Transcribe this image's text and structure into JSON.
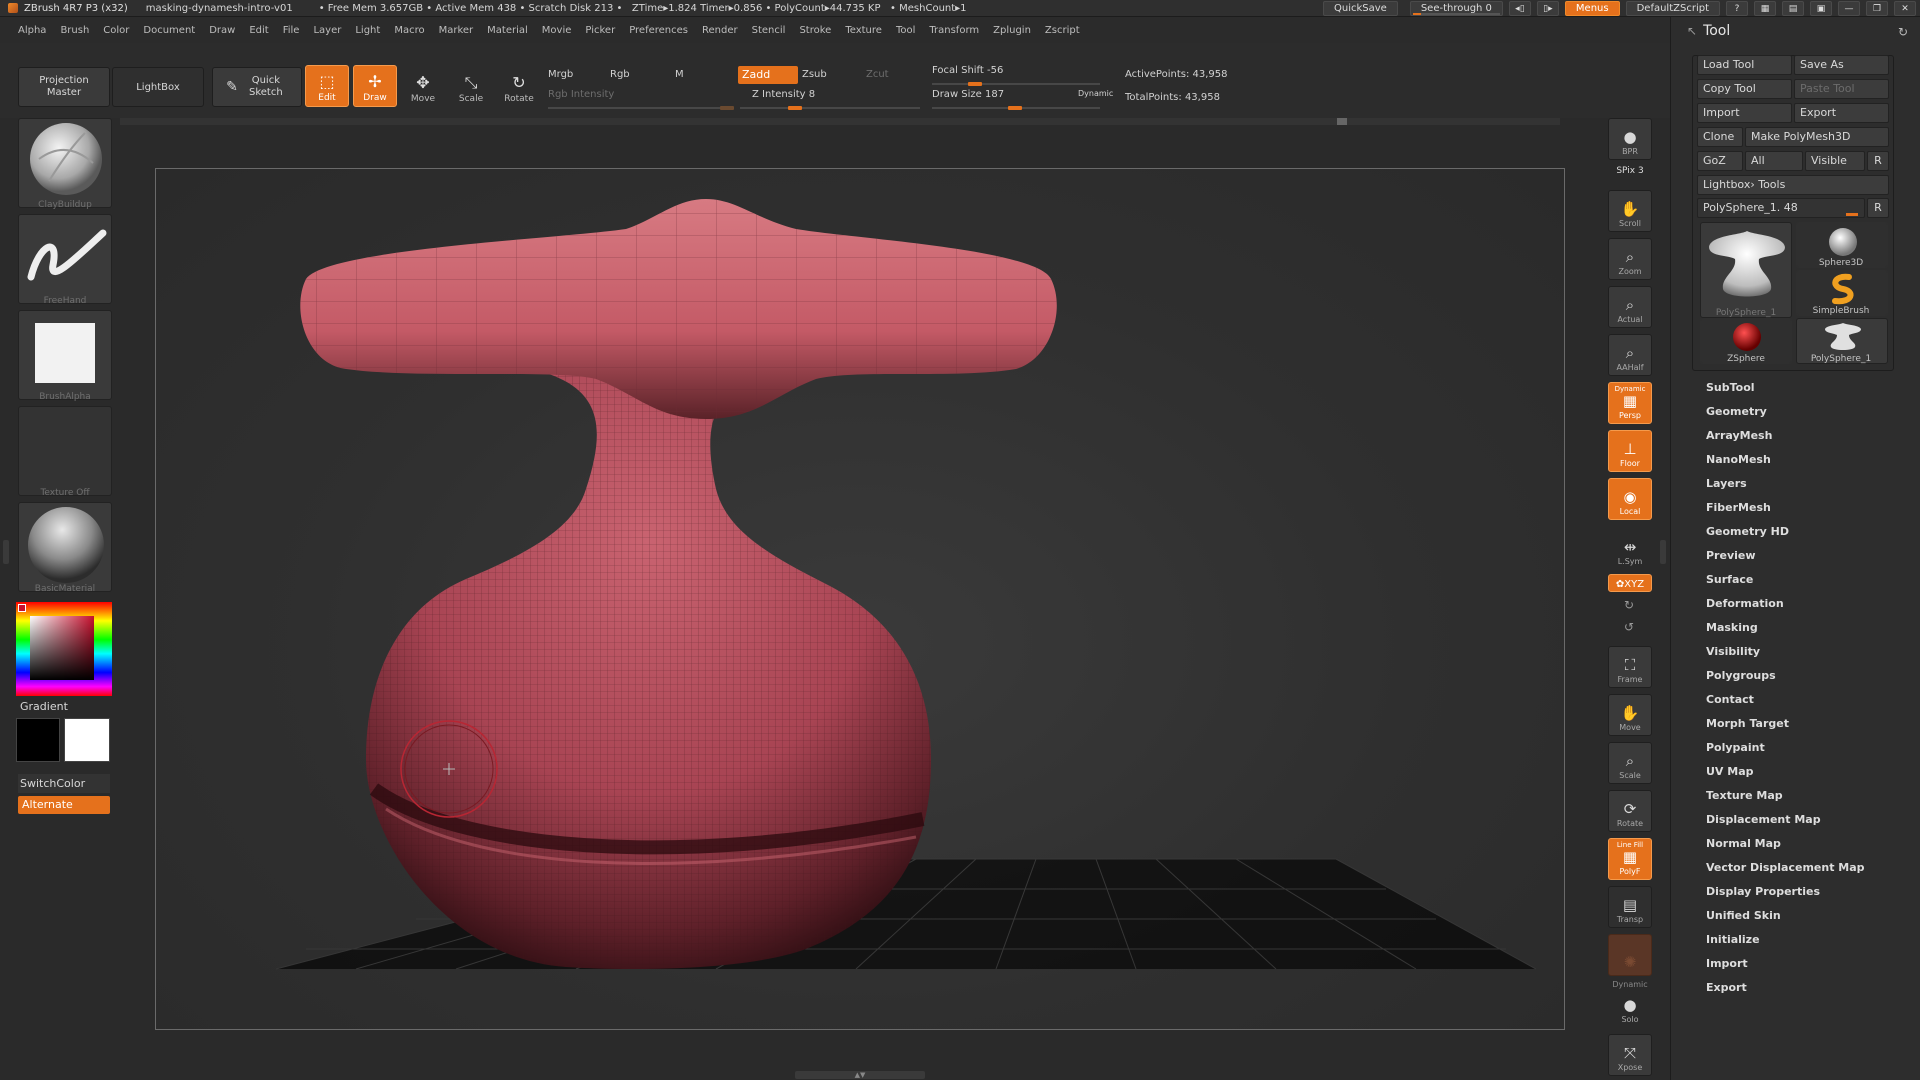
{
  "titlebar": {
    "app": "ZBrush 4R7 P3 (x32)",
    "document": "masking-dynamesh-intro-v01",
    "stats": "• Free Mem 3.657GB • Active Mem 438 • Scratch Disk 213 •   ZTime▸1.824 Timer▸0.856 • PolyCount▸44.735 KP   • MeshCount▸1",
    "quicksave": "QuickSave",
    "see_through": "See-through  0",
    "menus": "Menus",
    "default_zscript": "DefaultZScript"
  },
  "menubar": [
    "Alpha",
    "Brush",
    "Color",
    "Document",
    "Draw",
    "Edit",
    "File",
    "Layer",
    "Light",
    "Macro",
    "Marker",
    "Material",
    "Movie",
    "Picker",
    "Preferences",
    "Render",
    "Stencil",
    "Stroke",
    "Texture",
    "Tool",
    "Transform",
    "Zplugin",
    "Zscript"
  ],
  "shelf": {
    "projection_master": "Projection Master",
    "lightbox": "LightBox",
    "quick_sketch": "Quick Sketch",
    "edit": "Edit",
    "draw": "Draw",
    "move": "Move",
    "scale": "Scale",
    "rotate": "Rotate",
    "mrgb": "Mrgb",
    "rgb": "Rgb",
    "m": "M",
    "rgb_intensity": "Rgb Intensity",
    "zadd": "Zadd",
    "zsub": "Zsub",
    "zcut": "Zcut",
    "z_intensity": "Z Intensity 8",
    "focal_shift": "Focal Shift -56",
    "draw_size": "Draw Size 187",
    "dynamic": "Dynamic",
    "active_points": "ActivePoints: 43,958",
    "total_points": "TotalPoints: 43,958"
  },
  "left": {
    "brush": "ClayBuildup",
    "stroke": "FreeHand",
    "alpha": "BrushAlpha",
    "texture": "Texture Off",
    "material": "BasicMaterial",
    "gradient": "Gradient",
    "switch_color": "SwitchColor",
    "alternate": "Alternate"
  },
  "rightshelf": {
    "bpr": "BPR",
    "spix": "SPix 3",
    "scroll": "Scroll",
    "zoom": "Zoom",
    "actual": "Actual",
    "aahalf": "AAHalf",
    "dynamic_label": "Dynamic",
    "persp": "Persp",
    "floor": "Floor",
    "local": "Local",
    "lsym": "L.Sym",
    "xyz": "✿XYZ",
    "frame": "Frame",
    "move": "Move",
    "scale": "Scale",
    "rotate": "Rotate",
    "line_fill": "Line Fill",
    "polyf": "PolyF",
    "transp": "Transp",
    "dynamic_solo": "Dynamic",
    "solo": "Solo",
    "xpose": "Xpose"
  },
  "tool": {
    "title": "Tool",
    "load_tool": "Load Tool",
    "save_as": "Save As",
    "copy_tool": "Copy Tool",
    "paste_tool": "Paste Tool",
    "import": "Import",
    "export": "Export",
    "clone": "Clone",
    "make_polymesh": "Make PolyMesh3D",
    "goz": "GoZ",
    "all": "All",
    "visible": "Visible",
    "r": "R",
    "lightbox_tools": "Lightbox› Tools",
    "current_tool": "PolySphere_1. 48",
    "thumbs": [
      "PolySphere_1",
      "Sphere3D",
      "SimpleBrush",
      "ZSphere",
      "PolySphere_1"
    ],
    "subpalettes": [
      "SubTool",
      "Geometry",
      "ArrayMesh",
      "NanoMesh",
      "Layers",
      "FiberMesh",
      "Geometry HD",
      "Preview",
      "Surface",
      "Deformation",
      "Masking",
      "Visibility",
      "Polygroups",
      "Contact",
      "Morph Target",
      "Polypaint",
      "UV Map",
      "Texture Map",
      "Displacement Map",
      "Normal Map",
      "Vector Displacement Map",
      "Display Properties",
      "Unified Skin",
      "Initialize",
      "Import",
      "Export"
    ]
  },
  "colors": {
    "accent": "#e5711c",
    "mesh": "#c45a66",
    "background": "#272727"
  }
}
